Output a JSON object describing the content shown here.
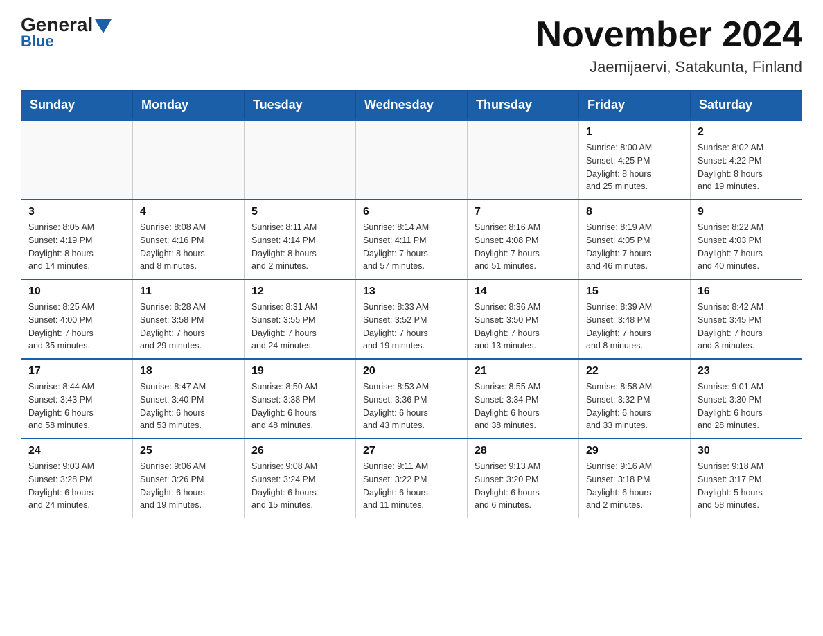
{
  "header": {
    "logo": {
      "general": "General",
      "blue": "Blue"
    },
    "title": "November 2024",
    "location": "Jaemijaervi, Satakunta, Finland"
  },
  "weekdays": [
    "Sunday",
    "Monday",
    "Tuesday",
    "Wednesday",
    "Thursday",
    "Friday",
    "Saturday"
  ],
  "weeks": [
    {
      "days": [
        {
          "number": "",
          "info": ""
        },
        {
          "number": "",
          "info": ""
        },
        {
          "number": "",
          "info": ""
        },
        {
          "number": "",
          "info": ""
        },
        {
          "number": "",
          "info": ""
        },
        {
          "number": "1",
          "info": "Sunrise: 8:00 AM\nSunset: 4:25 PM\nDaylight: 8 hours\nand 25 minutes."
        },
        {
          "number": "2",
          "info": "Sunrise: 8:02 AM\nSunset: 4:22 PM\nDaylight: 8 hours\nand 19 minutes."
        }
      ]
    },
    {
      "days": [
        {
          "number": "3",
          "info": "Sunrise: 8:05 AM\nSunset: 4:19 PM\nDaylight: 8 hours\nand 14 minutes."
        },
        {
          "number": "4",
          "info": "Sunrise: 8:08 AM\nSunset: 4:16 PM\nDaylight: 8 hours\nand 8 minutes."
        },
        {
          "number": "5",
          "info": "Sunrise: 8:11 AM\nSunset: 4:14 PM\nDaylight: 8 hours\nand 2 minutes."
        },
        {
          "number": "6",
          "info": "Sunrise: 8:14 AM\nSunset: 4:11 PM\nDaylight: 7 hours\nand 57 minutes."
        },
        {
          "number": "7",
          "info": "Sunrise: 8:16 AM\nSunset: 4:08 PM\nDaylight: 7 hours\nand 51 minutes."
        },
        {
          "number": "8",
          "info": "Sunrise: 8:19 AM\nSunset: 4:05 PM\nDaylight: 7 hours\nand 46 minutes."
        },
        {
          "number": "9",
          "info": "Sunrise: 8:22 AM\nSunset: 4:03 PM\nDaylight: 7 hours\nand 40 minutes."
        }
      ]
    },
    {
      "days": [
        {
          "number": "10",
          "info": "Sunrise: 8:25 AM\nSunset: 4:00 PM\nDaylight: 7 hours\nand 35 minutes."
        },
        {
          "number": "11",
          "info": "Sunrise: 8:28 AM\nSunset: 3:58 PM\nDaylight: 7 hours\nand 29 minutes."
        },
        {
          "number": "12",
          "info": "Sunrise: 8:31 AM\nSunset: 3:55 PM\nDaylight: 7 hours\nand 24 minutes."
        },
        {
          "number": "13",
          "info": "Sunrise: 8:33 AM\nSunset: 3:52 PM\nDaylight: 7 hours\nand 19 minutes."
        },
        {
          "number": "14",
          "info": "Sunrise: 8:36 AM\nSunset: 3:50 PM\nDaylight: 7 hours\nand 13 minutes."
        },
        {
          "number": "15",
          "info": "Sunrise: 8:39 AM\nSunset: 3:48 PM\nDaylight: 7 hours\nand 8 minutes."
        },
        {
          "number": "16",
          "info": "Sunrise: 8:42 AM\nSunset: 3:45 PM\nDaylight: 7 hours\nand 3 minutes."
        }
      ]
    },
    {
      "days": [
        {
          "number": "17",
          "info": "Sunrise: 8:44 AM\nSunset: 3:43 PM\nDaylight: 6 hours\nand 58 minutes."
        },
        {
          "number": "18",
          "info": "Sunrise: 8:47 AM\nSunset: 3:40 PM\nDaylight: 6 hours\nand 53 minutes."
        },
        {
          "number": "19",
          "info": "Sunrise: 8:50 AM\nSunset: 3:38 PM\nDaylight: 6 hours\nand 48 minutes."
        },
        {
          "number": "20",
          "info": "Sunrise: 8:53 AM\nSunset: 3:36 PM\nDaylight: 6 hours\nand 43 minutes."
        },
        {
          "number": "21",
          "info": "Sunrise: 8:55 AM\nSunset: 3:34 PM\nDaylight: 6 hours\nand 38 minutes."
        },
        {
          "number": "22",
          "info": "Sunrise: 8:58 AM\nSunset: 3:32 PM\nDaylight: 6 hours\nand 33 minutes."
        },
        {
          "number": "23",
          "info": "Sunrise: 9:01 AM\nSunset: 3:30 PM\nDaylight: 6 hours\nand 28 minutes."
        }
      ]
    },
    {
      "days": [
        {
          "number": "24",
          "info": "Sunrise: 9:03 AM\nSunset: 3:28 PM\nDaylight: 6 hours\nand 24 minutes."
        },
        {
          "number": "25",
          "info": "Sunrise: 9:06 AM\nSunset: 3:26 PM\nDaylight: 6 hours\nand 19 minutes."
        },
        {
          "number": "26",
          "info": "Sunrise: 9:08 AM\nSunset: 3:24 PM\nDaylight: 6 hours\nand 15 minutes."
        },
        {
          "number": "27",
          "info": "Sunrise: 9:11 AM\nSunset: 3:22 PM\nDaylight: 6 hours\nand 11 minutes."
        },
        {
          "number": "28",
          "info": "Sunrise: 9:13 AM\nSunset: 3:20 PM\nDaylight: 6 hours\nand 6 minutes."
        },
        {
          "number": "29",
          "info": "Sunrise: 9:16 AM\nSunset: 3:18 PM\nDaylight: 6 hours\nand 2 minutes."
        },
        {
          "number": "30",
          "info": "Sunrise: 9:18 AM\nSunset: 3:17 PM\nDaylight: 5 hours\nand 58 minutes."
        }
      ]
    }
  ]
}
